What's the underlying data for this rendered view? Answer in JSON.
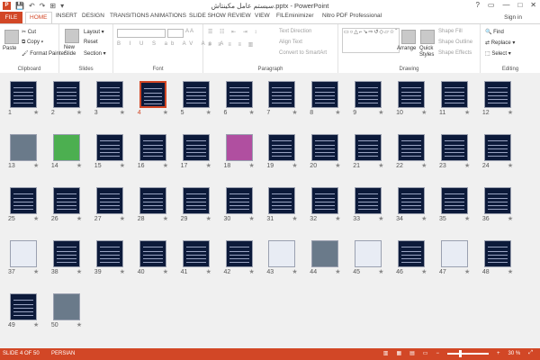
{
  "window": {
    "title": "سیستم عامل مکینتاش.pptx - PowerPoint",
    "controls": [
      "?",
      "▭",
      "—",
      "□",
      "✕"
    ]
  },
  "quick_access": {
    "app_letter": "P",
    "save": "💾",
    "undo": "↶",
    "redo": "↷",
    "start": "⊞",
    "customize": "▾"
  },
  "tabs": [
    {
      "label": "FILE"
    },
    {
      "label": "HOME"
    },
    {
      "label": "INSERT"
    },
    {
      "label": "DESIGN"
    },
    {
      "label": "TRANSITIONS"
    },
    {
      "label": "ANIMATIONS"
    },
    {
      "label": "SLIDE SHOW"
    },
    {
      "label": "REVIEW"
    },
    {
      "label": "VIEW"
    },
    {
      "label": "FILEminimizer"
    },
    {
      "label": "Nitro PDF Professional"
    }
  ],
  "active_tab": "HOME",
  "sign_in": "Sign in",
  "ribbon": {
    "clipboard": {
      "paste": "Paste",
      "cut": "Cut",
      "copy": "Copy",
      "format_painter": "Format Painter",
      "label": "Clipboard"
    },
    "slides": {
      "new_slide": "New Slide",
      "layout": "Layout",
      "reset": "Reset",
      "section": "Section",
      "label": "Slides"
    },
    "font": {
      "label": "Font"
    },
    "paragraph": {
      "text_direction": "Text Direction",
      "align_text": "Align Text",
      "convert": "Convert to SmartArt",
      "label": "Paragraph"
    },
    "drawing": {
      "arrange": "Arrange",
      "quick_styles": "Quick Styles",
      "shape_fill": "Shape Fill",
      "shape_outline": "Shape Outline",
      "shape_effects": "Shape Effects",
      "label": "Drawing"
    },
    "editing": {
      "find": "Find",
      "replace": "Replace",
      "select": "Select",
      "label": "Editing"
    }
  },
  "slides": [
    {
      "n": "1",
      "k": "dark"
    },
    {
      "n": "2",
      "k": "dark"
    },
    {
      "n": "3",
      "k": "dark"
    },
    {
      "n": "4",
      "k": "dark"
    },
    {
      "n": "5",
      "k": "dark"
    },
    {
      "n": "6",
      "k": "dark"
    },
    {
      "n": "7",
      "k": "dark"
    },
    {
      "n": "8",
      "k": "dark"
    },
    {
      "n": "9",
      "k": "dark"
    },
    {
      "n": "10",
      "k": "dark"
    },
    {
      "n": "11",
      "k": "dark"
    },
    {
      "n": "12",
      "k": "dark"
    },
    {
      "n": "13",
      "k": "photo"
    },
    {
      "n": "14",
      "k": "green"
    },
    {
      "n": "15",
      "k": "dark"
    },
    {
      "n": "16",
      "k": "dark"
    },
    {
      "n": "17",
      "k": "dark"
    },
    {
      "n": "18",
      "k": "pink"
    },
    {
      "n": "19",
      "k": "dark"
    },
    {
      "n": "20",
      "k": "dark"
    },
    {
      "n": "21",
      "k": "dark"
    },
    {
      "n": "22",
      "k": "dark"
    },
    {
      "n": "23",
      "k": "dark"
    },
    {
      "n": "24",
      "k": "dark"
    },
    {
      "n": "25",
      "k": "dark"
    },
    {
      "n": "26",
      "k": "dark"
    },
    {
      "n": "27",
      "k": "dark"
    },
    {
      "n": "28",
      "k": "dark"
    },
    {
      "n": "29",
      "k": "dark"
    },
    {
      "n": "30",
      "k": "dark"
    },
    {
      "n": "31",
      "k": "dark"
    },
    {
      "n": "32",
      "k": "dark"
    },
    {
      "n": "33",
      "k": "dark"
    },
    {
      "n": "34",
      "k": "dark"
    },
    {
      "n": "35",
      "k": "dark"
    },
    {
      "n": "36",
      "k": "dark"
    },
    {
      "n": "37",
      "k": "light"
    },
    {
      "n": "38",
      "k": "dark"
    },
    {
      "n": "39",
      "k": "dark"
    },
    {
      "n": "40",
      "k": "dark"
    },
    {
      "n": "41",
      "k": "dark"
    },
    {
      "n": "42",
      "k": "dark"
    },
    {
      "n": "43",
      "k": "light"
    },
    {
      "n": "44",
      "k": "photo"
    },
    {
      "n": "45",
      "k": "light"
    },
    {
      "n": "46",
      "k": "dark"
    },
    {
      "n": "47",
      "k": "light"
    },
    {
      "n": "48",
      "k": "dark"
    },
    {
      "n": "49",
      "k": "dark"
    },
    {
      "n": "50",
      "k": "photo"
    }
  ],
  "selected_slide": "4",
  "status": {
    "slide_info": "SLIDE 4 OF 50",
    "language": "PERSIAN",
    "zoom": "30 %",
    "zoom_level": 0.3
  },
  "colors": {
    "accent": "#d24726"
  }
}
